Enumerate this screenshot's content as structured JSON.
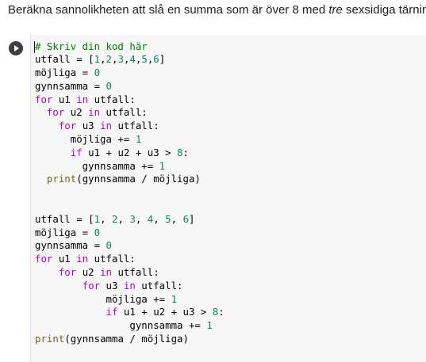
{
  "text_cell": {
    "before": "Beräkna sannolikheten att slå en summa som är över 8 med ",
    "emphasis": "tre",
    "after": " sexsidiga tärningar."
  },
  "code_cell": {
    "run_button_icon": "play-icon",
    "lines": [
      [
        {
          "t": "# Skriv din kod här",
          "c": "comment"
        }
      ],
      [
        {
          "t": "utfall = ["
        },
        {
          "t": "1",
          "c": "num"
        },
        {
          "t": ","
        },
        {
          "t": "2",
          "c": "num"
        },
        {
          "t": ","
        },
        {
          "t": "3",
          "c": "num"
        },
        {
          "t": ","
        },
        {
          "t": "4",
          "c": "num"
        },
        {
          "t": ","
        },
        {
          "t": "5",
          "c": "num"
        },
        {
          "t": ","
        },
        {
          "t": "6",
          "c": "num"
        },
        {
          "t": "]"
        }
      ],
      [
        {
          "t": "möjliga = "
        },
        {
          "t": "0",
          "c": "num"
        }
      ],
      [
        {
          "t": "gynnsamma = "
        },
        {
          "t": "0",
          "c": "num"
        }
      ],
      [
        {
          "t": "for",
          "c": "kw"
        },
        {
          "t": " u1 "
        },
        {
          "t": "in",
          "c": "kw"
        },
        {
          "t": " utfall:"
        }
      ],
      [
        {
          "t": "  "
        },
        {
          "t": "for",
          "c": "kw"
        },
        {
          "t": " u2 "
        },
        {
          "t": "in",
          "c": "kw"
        },
        {
          "t": " utfall:"
        }
      ],
      [
        {
          "t": "    "
        },
        {
          "t": "for",
          "c": "kw"
        },
        {
          "t": " u3 "
        },
        {
          "t": "in",
          "c": "kw"
        },
        {
          "t": " utfall:"
        }
      ],
      [
        {
          "t": "      möjliga += "
        },
        {
          "t": "1",
          "c": "num"
        }
      ],
      [
        {
          "t": "      "
        },
        {
          "t": "if",
          "c": "kw"
        },
        {
          "t": " u1 + u2 + u3 > "
        },
        {
          "t": "8",
          "c": "num"
        },
        {
          "t": ":"
        }
      ],
      [
        {
          "t": "        gynnsamma += "
        },
        {
          "t": "1",
          "c": "num"
        }
      ],
      [
        {
          "t": "  "
        },
        {
          "t": "print",
          "c": "builtin"
        },
        {
          "t": "(gynnsamma / möjliga)"
        }
      ],
      [],
      [],
      [
        {
          "t": "utfall = ["
        },
        {
          "t": "1",
          "c": "num"
        },
        {
          "t": ", "
        },
        {
          "t": "2",
          "c": "num"
        },
        {
          "t": ", "
        },
        {
          "t": "3",
          "c": "num"
        },
        {
          "t": ", "
        },
        {
          "t": "4",
          "c": "num"
        },
        {
          "t": ", "
        },
        {
          "t": "5",
          "c": "num"
        },
        {
          "t": ", "
        },
        {
          "t": "6",
          "c": "num"
        },
        {
          "t": "]"
        }
      ],
      [
        {
          "t": "möjliga = "
        },
        {
          "t": "0",
          "c": "num"
        }
      ],
      [
        {
          "t": "gynnsamma = "
        },
        {
          "t": "0",
          "c": "num"
        }
      ],
      [
        {
          "t": "for",
          "c": "kw"
        },
        {
          "t": " u1 "
        },
        {
          "t": "in",
          "c": "kw"
        },
        {
          "t": " utfall:"
        }
      ],
      [
        {
          "t": "    "
        },
        {
          "t": "for",
          "c": "kw"
        },
        {
          "t": " u2 "
        },
        {
          "t": "in",
          "c": "kw"
        },
        {
          "t": " utfall:"
        }
      ],
      [
        {
          "t": "        "
        },
        {
          "t": "for",
          "c": "kw"
        },
        {
          "t": " u3 "
        },
        {
          "t": "in",
          "c": "kw"
        },
        {
          "t": " utfall:"
        }
      ],
      [
        {
          "t": "            möjliga += "
        },
        {
          "t": "1",
          "c": "num"
        }
      ],
      [
        {
          "t": "            "
        },
        {
          "t": "if",
          "c": "kw"
        },
        {
          "t": " u1 + u2 + u3 > "
        },
        {
          "t": "8",
          "c": "num"
        },
        {
          "t": ":"
        }
      ],
      [
        {
          "t": "                gynnsamma += "
        },
        {
          "t": "1",
          "c": "num"
        }
      ],
      [
        {
          "t": "print",
          "c": "builtin"
        },
        {
          "t": "(gynnsamma / möjliga)"
        }
      ]
    ]
  },
  "colors": {
    "comment": "#008000",
    "keyword": "#af00db",
    "number": "#098658",
    "builtin": "#795e26",
    "editor_background": "#f7f7f7"
  }
}
